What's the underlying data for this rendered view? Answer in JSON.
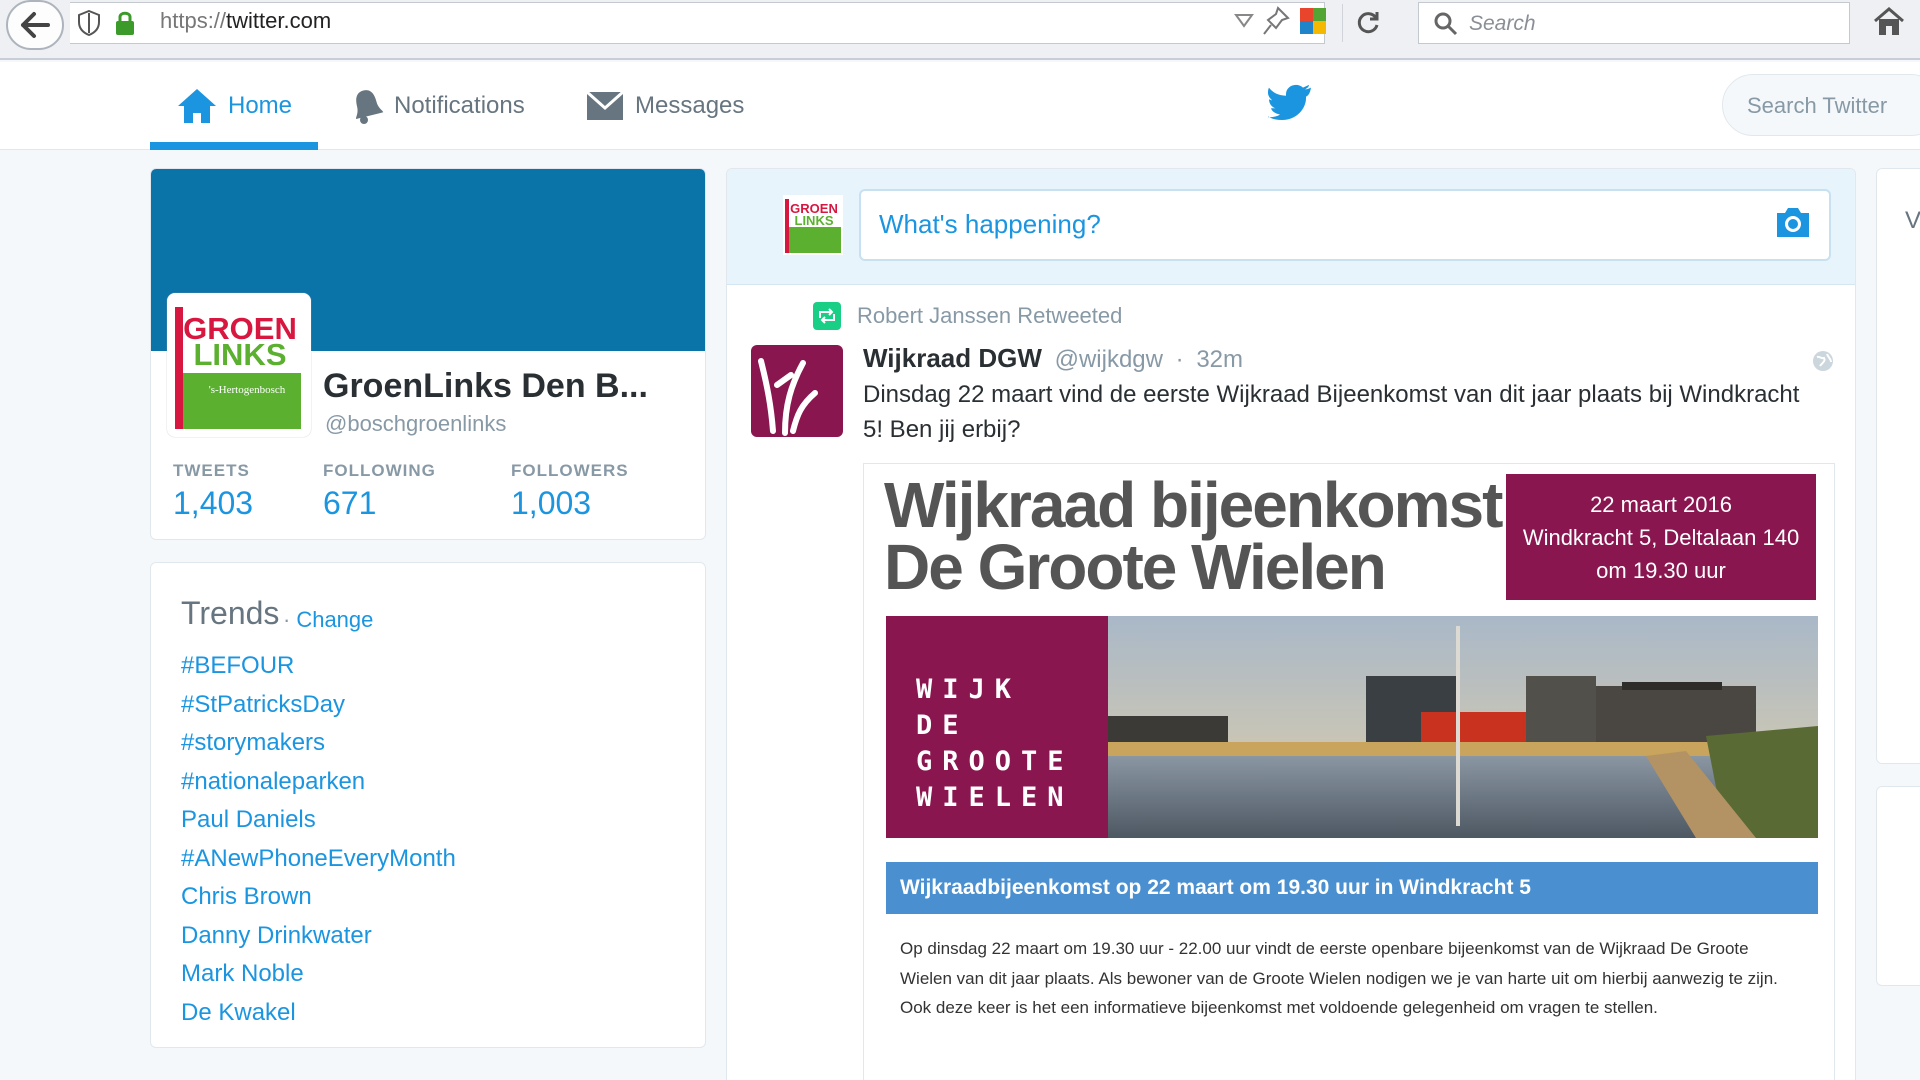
{
  "browser": {
    "url_scheme": "https://",
    "url_host": "twitter.com",
    "search_placeholder": "Search"
  },
  "nav": {
    "home_label": "Home",
    "notifications_label": "Notifications",
    "messages_label": "Messages",
    "search_placeholder": "Search Twitter",
    "accent_color": "#1b95e0"
  },
  "profile": {
    "name": "GroenLinks Den B...",
    "handle": "@boschgroenlinks",
    "avatar_logo_line1": "GROEN",
    "avatar_logo_line2": "LINKS",
    "avatar_logo_line3": "'s-Hertogenbosch",
    "stats": [
      {
        "label": "TWEETS",
        "value": "1,403"
      },
      {
        "label": "FOLLOWING",
        "value": "671"
      },
      {
        "label": "FOLLOWERS",
        "value": "1,003"
      }
    ]
  },
  "trends": {
    "title": "Trends",
    "change_label": "Change",
    "items": [
      "#BEFOUR",
      "#StPatricksDay",
      "#storymakers",
      "#nationaleparken",
      "Paul Daniels",
      "#ANewPhoneEveryMonth",
      "Chris Brown",
      "Danny Drinkwater",
      "Mark Noble",
      "De Kwakel"
    ]
  },
  "composer": {
    "placeholder": "What's happening?"
  },
  "tweet": {
    "retweet_context": "Robert Janssen Retweeted",
    "author_name": "Wijkraad DGW",
    "author_handle": "@wijkdgw",
    "separator": "·",
    "timestamp": "32m",
    "text": "Dinsdag 22 maart vind de eerste Wijkraad Bijeenkomst van dit jaar plaats bij Windkracht 5! Ben jij erbij?",
    "media": {
      "title_line1": "Wijkraad bijeenkomst",
      "title_line2": "De Groote Wielen",
      "date_line1": "22 maart 2016",
      "date_line2": "Windkracht 5, Deltalaan 140",
      "date_line3": "om 19.30 uur",
      "wijk_lines": [
        "WIJK",
        "DE",
        "GROOTE",
        "WIELEN"
      ],
      "banner": "Wijkraadbijeenkomst op 22 maart om 19.30 uur in Windkracht 5",
      "body": "Op dinsdag 22 maart om 19.30 uur - 22.00 uur vindt de eerste openbare bijeenkomst van de Wijkraad De Groote Wielen van dit jaar plaats. Als bewoner van de Groote Wielen nodigen we je van harte uit om hierbij aanwezig te zijn. Ook deze keer is het een informatieve bijeenkomst met voldoende gelegenheid om vragen te stellen."
    }
  }
}
